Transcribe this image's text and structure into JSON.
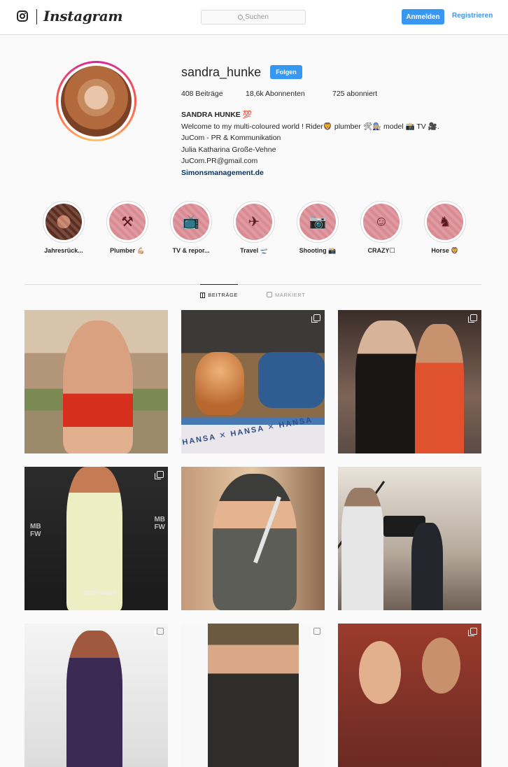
{
  "nav": {
    "brand": "Instagram",
    "search_placeholder": "Suchen",
    "login_label": "Anmelden",
    "register_label": "Registrieren",
    "accent": "#3897f0"
  },
  "profile": {
    "username": "sandra_hunke",
    "follow_label": "Folgen",
    "posts": "408 Beiträge",
    "followers": "18,6k Abonnenten",
    "following": "725 abonniert",
    "bio": {
      "name": "SANDRA HUNKE 💯",
      "line1": "Welcome to my multi-coloured world ! Rider🦁 plumber 🛠👩🏼‍🔧 model 📸 TV 🎥.",
      "line2": "JuCom - PR & Kommunikation",
      "line3": "Julia Katharina Große-Vehne",
      "line4": "JuCom.PR@gmail.com",
      "website": "Simonsmanagement.de"
    }
  },
  "highlights": [
    {
      "label": "Jahresrück...",
      "icon": "portrait-photo"
    },
    {
      "label": "Plumber 💪🏼",
      "icon": "plumber-icon"
    },
    {
      "label": "TV & repor...",
      "icon": "tv-icon"
    },
    {
      "label": "Travel 🛫",
      "icon": "plane-icon"
    },
    {
      "label": "Shooting 📸",
      "icon": "camera-icon"
    },
    {
      "label": "CRAZY☐",
      "icon": "emoji-icon"
    },
    {
      "label": "Horse 🦁",
      "icon": "horse-icon"
    }
  ],
  "tabs": {
    "posts": "BEITRÄGE",
    "tagged": "MARKIERT"
  },
  "posts": {
    "p2_text": "HANSA ✕ HANSA ✕ HANSA",
    "p4_mb": "MB\nFW",
    "p4_getty": "gettyimages"
  }
}
